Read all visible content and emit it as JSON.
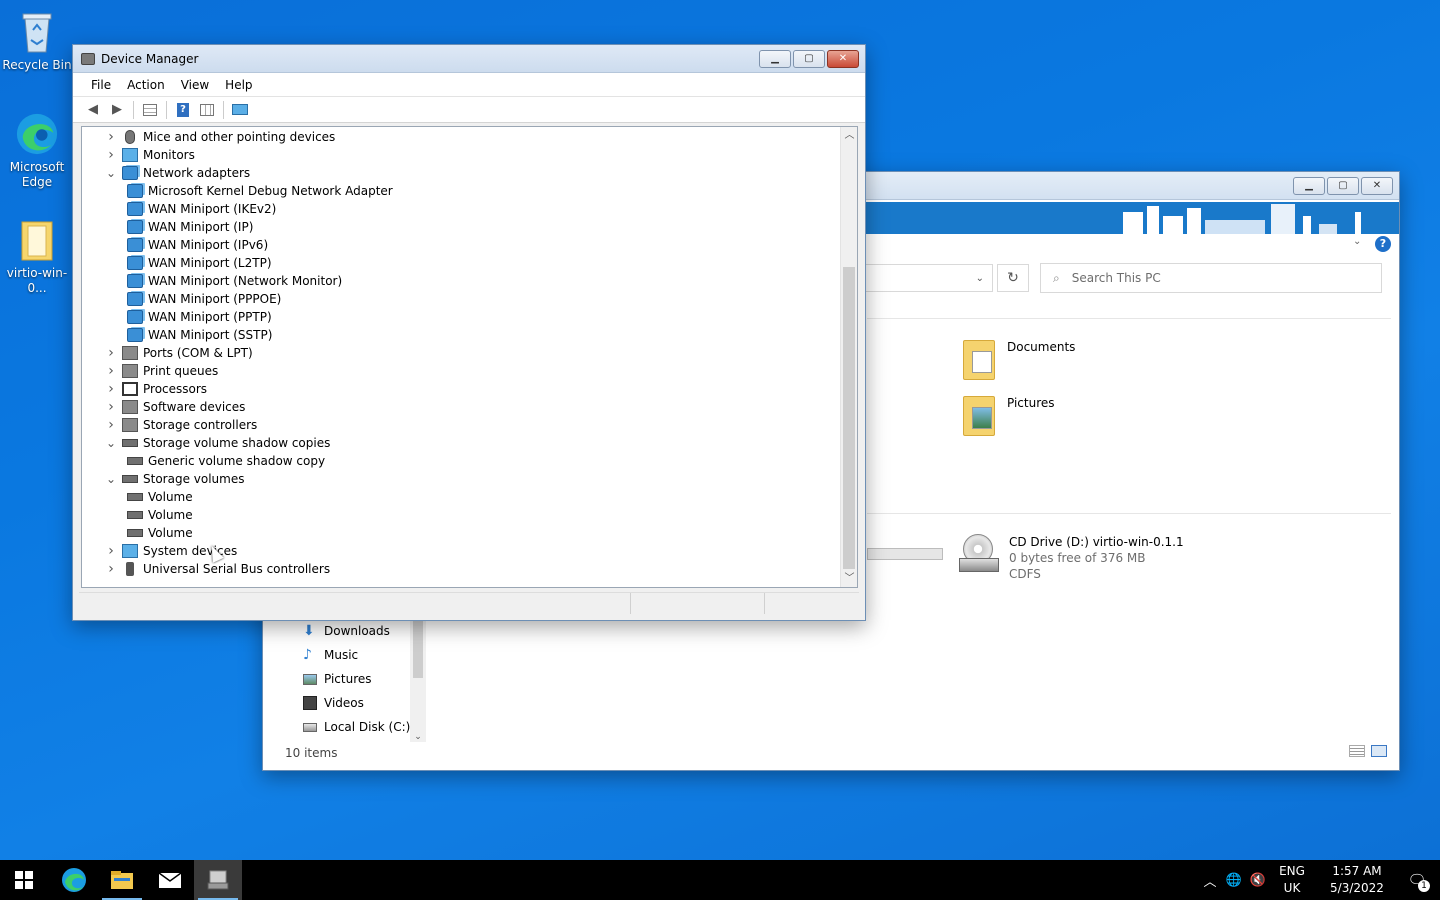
{
  "desktop": {
    "icons": [
      {
        "label": "Recycle Bin"
      },
      {
        "label": "Microsoft Edge"
      },
      {
        "label": "virtio-win-0..."
      }
    ]
  },
  "device_manager": {
    "title": "Device Manager",
    "menu": [
      "File",
      "Action",
      "View",
      "Help"
    ],
    "toolbar_icons": [
      "back-arrow-icon",
      "forward-arrow-icon",
      "properties-icon",
      "help-icon",
      "view-icon",
      "monitor-scan-icon"
    ],
    "tree": [
      {
        "label": "Mice and other pointing devices",
        "level": 0,
        "state": "collapsed",
        "icon": "mouse-icon"
      },
      {
        "label": "Monitors",
        "level": 0,
        "state": "collapsed",
        "icon": "monitor-icon"
      },
      {
        "label": "Network adapters",
        "level": 0,
        "state": "expanded",
        "icon": "network-icon"
      },
      {
        "label": "Microsoft Kernel Debug Network Adapter",
        "level": 1,
        "icon": "network-icon"
      },
      {
        "label": "WAN Miniport (IKEv2)",
        "level": 1,
        "icon": "network-icon"
      },
      {
        "label": "WAN Miniport (IP)",
        "level": 1,
        "icon": "network-icon"
      },
      {
        "label": "WAN Miniport (IPv6)",
        "level": 1,
        "icon": "network-icon"
      },
      {
        "label": "WAN Miniport (L2TP)",
        "level": 1,
        "icon": "network-icon"
      },
      {
        "label": "WAN Miniport (Network Monitor)",
        "level": 1,
        "icon": "network-icon"
      },
      {
        "label": "WAN Miniport (PPPOE)",
        "level": 1,
        "icon": "network-icon"
      },
      {
        "label": "WAN Miniport (PPTP)",
        "level": 1,
        "icon": "network-icon"
      },
      {
        "label": "WAN Miniport (SSTP)",
        "level": 1,
        "icon": "network-icon"
      },
      {
        "label": "Ports (COM & LPT)",
        "level": 0,
        "state": "collapsed",
        "icon": "port-icon"
      },
      {
        "label": "Print queues",
        "level": 0,
        "state": "collapsed",
        "icon": "printer-icon"
      },
      {
        "label": "Processors",
        "level": 0,
        "state": "collapsed",
        "icon": "processor-icon"
      },
      {
        "label": "Software devices",
        "level": 0,
        "state": "collapsed",
        "icon": "software-device-icon"
      },
      {
        "label": "Storage controllers",
        "level": 0,
        "state": "collapsed",
        "icon": "storage-controller-icon"
      },
      {
        "label": "Storage volume shadow copies",
        "level": 0,
        "state": "expanded",
        "icon": "drive-icon"
      },
      {
        "label": "Generic volume shadow copy",
        "level": 1,
        "icon": "drive-icon"
      },
      {
        "label": "Storage volumes",
        "level": 0,
        "state": "expanded",
        "icon": "drive-icon"
      },
      {
        "label": "Volume",
        "level": 1,
        "icon": "volume-icon"
      },
      {
        "label": "Volume",
        "level": 1,
        "icon": "volume-icon"
      },
      {
        "label": "Volume",
        "level": 1,
        "icon": "volume-icon"
      },
      {
        "label": "System devices",
        "level": 0,
        "state": "collapsed",
        "icon": "system-icon"
      },
      {
        "label": "Universal Serial Bus controllers",
        "level": 0,
        "state": "collapsed",
        "icon": "usb-icon"
      }
    ]
  },
  "explorer": {
    "search_placeholder": "Search This PC",
    "folders": [
      {
        "label": "Documents"
      },
      {
        "label": "Pictures"
      }
    ],
    "drive": {
      "label": "CD Drive (D:) virtio-win-0.1.1",
      "free": "0 bytes free of 376 MB",
      "fs": "CDFS"
    },
    "nav": [
      {
        "label": "Downloads",
        "icon": "download-icon"
      },
      {
        "label": "Music",
        "icon": "music-icon"
      },
      {
        "label": "Pictures",
        "icon": "pictures-icon"
      },
      {
        "label": "Videos",
        "icon": "videos-icon"
      },
      {
        "label": "Local Disk (C:)",
        "icon": "local-disk-icon"
      }
    ],
    "status": "10 items"
  },
  "taskbar": {
    "apps": [
      "start-icon",
      "edge-icon",
      "file-explorer-icon",
      "mail-icon",
      "device-manager-icon"
    ],
    "lang_top": "ENG",
    "lang_bottom": "UK",
    "time": "1:57 AM",
    "date": "5/3/2022",
    "notification_count": "1"
  }
}
